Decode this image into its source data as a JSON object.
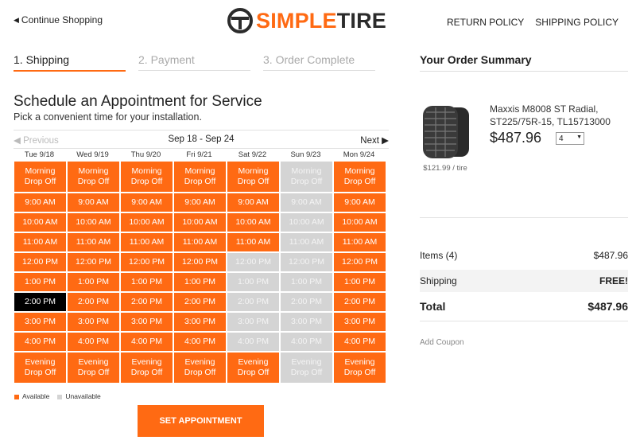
{
  "header": {
    "continue_label": "Continue Shopping",
    "brand_simple": "SIMPLE",
    "brand_tire": "TIRE",
    "links": [
      "RETURN POLICY",
      "SHIPPING POLICY"
    ]
  },
  "steps": [
    "1. Shipping",
    "2. Payment",
    "3. Order Complete"
  ],
  "schedule": {
    "title": "Schedule an Appointment for Service",
    "subtitle": "Pick a convenient time for your installation.",
    "prev_label": "Previous",
    "range": "Sep 18 - Sep 24",
    "next_label": "Next",
    "days": [
      "Tue 9/18",
      "Wed 9/19",
      "Thu 9/20",
      "Fri 9/21",
      "Sat 9/22",
      "Sun 9/23",
      "Mon 9/24"
    ],
    "slot_labels": [
      "Morning\nDrop Off",
      "9:00 AM",
      "10:00 AM",
      "11:00 AM",
      "12:00 PM",
      "1:00 PM",
      "2:00 PM",
      "3:00 PM",
      "4:00 PM",
      "Evening\nDrop Off"
    ],
    "availability": [
      [
        1,
        1,
        1,
        1,
        1,
        0,
        1
      ],
      [
        1,
        1,
        1,
        1,
        1,
        0,
        1
      ],
      [
        1,
        1,
        1,
        1,
        1,
        0,
        1
      ],
      [
        1,
        1,
        1,
        1,
        1,
        0,
        1
      ],
      [
        1,
        1,
        1,
        1,
        0,
        0,
        1
      ],
      [
        1,
        1,
        1,
        1,
        0,
        0,
        1
      ],
      [
        1,
        1,
        1,
        1,
        0,
        0,
        1
      ],
      [
        1,
        1,
        1,
        1,
        0,
        0,
        1
      ],
      [
        1,
        1,
        1,
        1,
        0,
        0,
        1
      ],
      [
        1,
        1,
        1,
        1,
        1,
        0,
        1
      ]
    ],
    "selected": {
      "day": "Tue 9/18",
      "slot": "2:00 PM"
    },
    "legend_available": "Available",
    "legend_unavailable": "Unavailable",
    "button_label": "SET APPOINTMENT"
  },
  "summary": {
    "title": "Your Order Summary",
    "product_name": "Maxxis M8008 ST Radial, ST225/75R-15, TL15713000",
    "price": "$487.96",
    "quantity": "4",
    "unit_price": "$121.99 / tire",
    "items_label": "Items (4)",
    "items_value": "$487.96",
    "shipping_label": "Shipping",
    "shipping_value": "FREE!",
    "total_label": "Total",
    "total_value": "$487.96",
    "coupon_label": "Add Coupon"
  },
  "colors": {
    "accent": "#ff6a13",
    "unavailable": "#d4d4d4",
    "selected": "#000000"
  }
}
